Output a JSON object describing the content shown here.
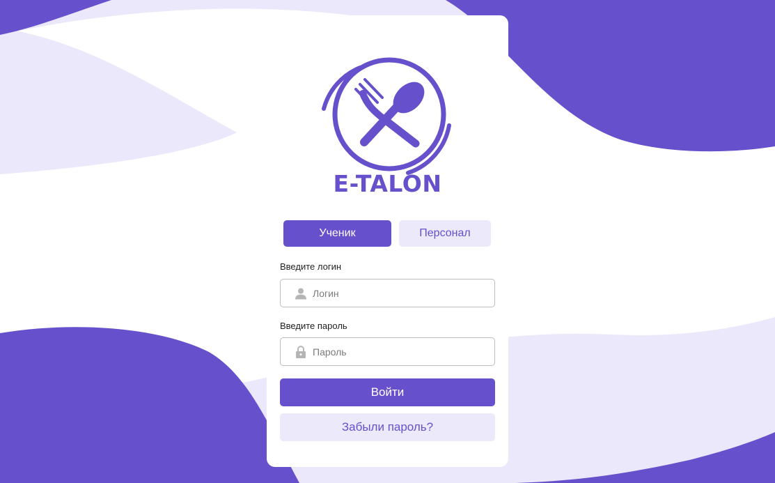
{
  "app": {
    "brand": "E-TALON"
  },
  "tabs": [
    {
      "label": "Ученик",
      "active": true
    },
    {
      "label": "Персонал",
      "active": false
    }
  ],
  "login": {
    "label": "Введите логин",
    "placeholder": "Логин",
    "value": "",
    "icon": "user-icon"
  },
  "password": {
    "label": "Введите пароль",
    "placeholder": "Пароль",
    "value": "",
    "icon": "lock-icon"
  },
  "actions": {
    "submit_label": "Войти",
    "forgot_label": "Забыли пароль?"
  },
  "colors": {
    "accent": "#6650cc",
    "accent_light": "#ece9fb",
    "background_wave": "#6650cc",
    "background_wave_light": "#ebe8fb"
  }
}
